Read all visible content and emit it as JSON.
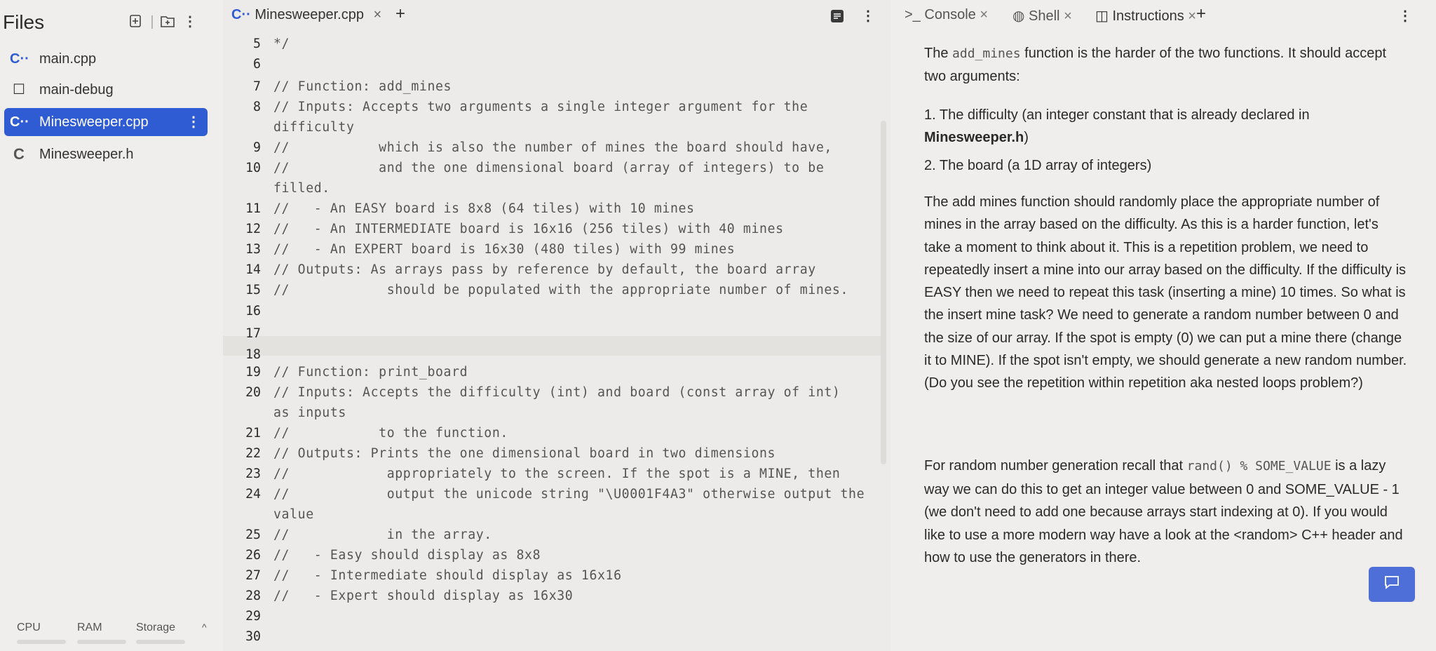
{
  "files": {
    "title": "Files",
    "items": [
      {
        "icon": "C··",
        "name": "main.cpp"
      },
      {
        "icon": "☐",
        "name": "main-debug"
      },
      {
        "icon": "C··",
        "name": "Minesweeper.cpp"
      },
      {
        "icon": "C",
        "name": "Minesweeper.h"
      }
    ]
  },
  "resources": {
    "cpu": "CPU",
    "ram": "RAM",
    "storage": "Storage"
  },
  "editor": {
    "tab_icon": "C··",
    "tab_label": "Minesweeper.cpp",
    "lines": [
      {
        "n": "5",
        "t": "*/"
      },
      {
        "n": "6",
        "t": ""
      },
      {
        "n": "7",
        "t": "// Function: add_mines"
      },
      {
        "n": "8",
        "t": "// Inputs: Accepts two arguments a single integer argument for the",
        "c": "difficulty"
      },
      {
        "n": "9",
        "t": "//           which is also the number of mines the board should have,"
      },
      {
        "n": "10",
        "t": "//           and the one dimensional board (array of integers) to be",
        "c": "filled."
      },
      {
        "n": "11",
        "t": "//   - An EASY board is 8x8 (64 tiles) with 10 mines"
      },
      {
        "n": "12",
        "t": "//   - An INTERMEDIATE board is 16x16 (256 tiles) with 40 mines"
      },
      {
        "n": "13",
        "t": "//   - An EXPERT board is 16x30 (480 tiles) with 99 mines"
      },
      {
        "n": "14",
        "t": "// Outputs: As arrays pass by reference by default, the board array"
      },
      {
        "n": "15",
        "t": "//            should be populated with the appropriate number of mines."
      },
      {
        "n": "16",
        "t": ""
      },
      {
        "n": "17",
        "t": ""
      },
      {
        "n": "18",
        "t": ""
      },
      {
        "n": "19",
        "t": "// Function: print_board"
      },
      {
        "n": "20",
        "t": "// Inputs: Accepts the difficulty (int) and board (const array of int)",
        "c": "as inputs"
      },
      {
        "n": "21",
        "t": "//           to the function."
      },
      {
        "n": "22",
        "t": "// Outputs: Prints the one dimensional board in two dimensions"
      },
      {
        "n": "23",
        "t": "//            appropriately to the screen. If the spot is a MINE, then"
      },
      {
        "n": "24",
        "t": "//            output the unicode string \"\\U0001F4A3\" otherwise output the",
        "c": "value"
      },
      {
        "n": "25",
        "t": "//            in the array."
      },
      {
        "n": "26",
        "t": "//   - Easy should display as 8x8"
      },
      {
        "n": "27",
        "t": "//   - Intermediate should display as 16x16"
      },
      {
        "n": "28",
        "t": "//   - Expert should display as 16x30"
      },
      {
        "n": "29",
        "t": ""
      },
      {
        "n": "30",
        "t": ""
      }
    ]
  },
  "right_tabs": {
    "console": "Console",
    "shell": "Shell",
    "instructions": "Instructions"
  },
  "instructions": {
    "p1_a": "The ",
    "p1_code": "add_mines",
    "p1_b": " function is the harder of the two functions. It should accept two arguments:",
    "li1_a": "1. The difficulty (an integer constant that is already declared in ",
    "li1_b": "Minesweeper.h",
    "li1_c": ")",
    "li2": "2. The board (a 1D array of integers)",
    "p2": "The add mines function should randomly place the appropriate number of mines in the array based on the difficulty. As this is a harder function, let's take a moment to think about it. This is a repetition problem, we need to repeatedly insert a mine into our array based on the difficulty. If the difficulty is EASY then we need to repeat this task (inserting a mine) 10 times. So what is the insert mine task? We need to generate a random number between 0 and the size of our array. If the spot is empty (0) we can put a mine there (change it to MINE). If the spot isn't empty, we should generate a new random number. (Do you see the repetition within repetition aka nested loops problem?)",
    "p3_a": "For random number generation recall that ",
    "p3_code": "rand() % SOME_VALUE",
    "p3_b": " is a lazy way we can do this to get an integer value between 0 and SOME_VALUE - 1 (we don't need to add one because arrays start indexing at 0). If you would like to use a more modern way have a look at the <random> C++ header and how to use the generators in there."
  },
  "colors": {
    "accent": "#2f5bd3",
    "chat": "#4f6fd8"
  }
}
